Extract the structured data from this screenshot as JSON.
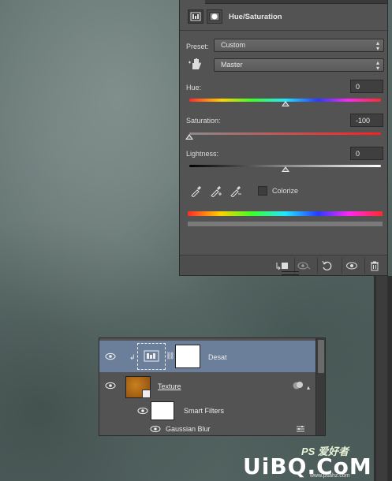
{
  "properties": {
    "title": "Hue/Saturation",
    "preset_label": "Preset:",
    "preset_value": "Custom",
    "channel_value": "Master",
    "hue_label": "Hue:",
    "hue_value": "0",
    "hue_level": 0.5,
    "saturation_label": "Saturation:",
    "saturation_value": "-100",
    "saturation_level": 0.0,
    "lightness_label": "Lightness:",
    "lightness_value": "0",
    "lightness_level": 0.5,
    "colorize_label": "Colorize",
    "colorize_checked": false
  },
  "layers": {
    "rows": [
      {
        "name": "Desat",
        "selected": true
      },
      {
        "name": "Texture",
        "selected": false
      },
      {
        "name": "Smart Filters",
        "selected": false
      },
      {
        "name": "Gaussian Blur",
        "selected": false
      }
    ]
  },
  "watermark": {
    "brand": "UiBQ.CoM",
    "ps_text": "PS 爱好者",
    "site_text": "www.psahz.com"
  },
  "colors": {
    "panel": "#535353",
    "selected_row": "#6c7f9a",
    "canvas": "#5e6f6c"
  }
}
